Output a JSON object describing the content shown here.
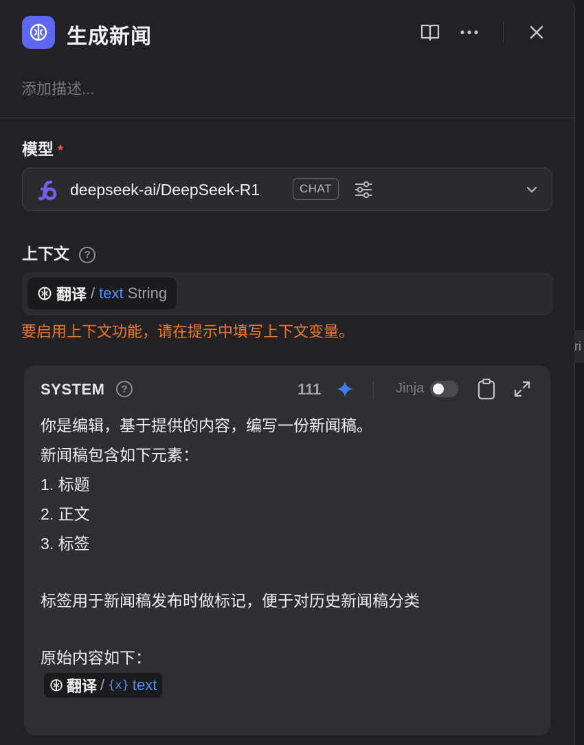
{
  "header": {
    "title": "生成新闻",
    "description_placeholder": "添加描述..."
  },
  "model": {
    "label": "模型",
    "required_mark": "*",
    "name": "deepseek-ai/DeepSeek-R1",
    "mode_badge": "CHAT"
  },
  "context": {
    "label": "上下文",
    "chip": {
      "node": "翻译",
      "separator": "/",
      "variable": "text",
      "type": "String"
    },
    "warning": "要启用上下文功能，请在提示中填写上下文变量。"
  },
  "system_prompt": {
    "role": "SYSTEM",
    "token_count": "111",
    "jinja_label": "Jinja",
    "jinja_enabled": false,
    "lines": [
      "你是编辑，基于提供的内容，编写一份新闻稿。",
      "新闻稿包含如下元素：",
      "1. 标题",
      "2. 正文",
      "3. 标签",
      "标签用于新闻稿发布时做标记，便于对历史新闻稿分类",
      "原始内容如下："
    ],
    "variable_chip": {
      "node": "翻译",
      "separator": "/",
      "symbol": "{x}",
      "variable": "text"
    }
  },
  "side_peek_text": "ri",
  "colors": {
    "accent": "#5d67f0",
    "variable": "#4e8ef7",
    "warning": "#f0772a",
    "required": "#ef5350",
    "deepseek_logo": "#7c5cf0"
  },
  "icons": [
    "brain-icon",
    "book-icon",
    "more-icon",
    "close-icon",
    "deepseek-logo-icon",
    "sliders-icon",
    "chevron-down-icon",
    "help-icon",
    "sparkle-icon",
    "clipboard-icon",
    "expand-icon"
  ]
}
